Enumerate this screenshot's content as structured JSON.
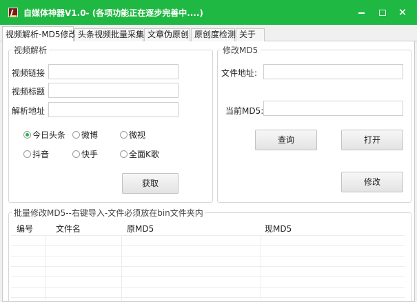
{
  "window": {
    "title": "自媒体神器V1.0-  (各项功能正在逐步完善中....)",
    "controls": {
      "minimize": "–",
      "maximize": "□",
      "close": "✕"
    }
  },
  "tabs": [
    {
      "label": "视频解析-MD5修改",
      "active": true
    },
    {
      "label": "头条视频批量采集",
      "active": false
    },
    {
      "label": "文章伪原创",
      "active": false
    },
    {
      "label": "原创度检测",
      "active": false
    },
    {
      "label": "关于",
      "active": false
    }
  ],
  "video_parse": {
    "legend": "视频解析",
    "fields": [
      {
        "label": "视频链接",
        "value": ""
      },
      {
        "label": "视频标题",
        "value": ""
      },
      {
        "label": "解析地址",
        "value": ""
      }
    ],
    "platforms": [
      {
        "label": "今日头条",
        "selected": true
      },
      {
        "label": "微博",
        "selected": false
      },
      {
        "label": "微视",
        "selected": false
      },
      {
        "label": "抖音",
        "selected": false
      },
      {
        "label": "快手",
        "selected": false
      },
      {
        "label": "全面K歌",
        "selected": false
      }
    ],
    "fetch_button": "获取"
  },
  "md5_modify": {
    "legend": "修改MD5",
    "file_path_label": "文件地址:",
    "file_path_value": "",
    "current_md5_label": "当前MD5:",
    "current_md5_value": "",
    "query_button": "查询",
    "open_button": "打开",
    "modify_button": "修改"
  },
  "batch": {
    "legend": "批量修改MD5--右键导入-文件必须放在bin文件夹内",
    "columns": [
      "编号",
      "文件名",
      "原MD5",
      "现MD5"
    ],
    "rows": []
  },
  "colors": {
    "accent": "#1fb842"
  }
}
